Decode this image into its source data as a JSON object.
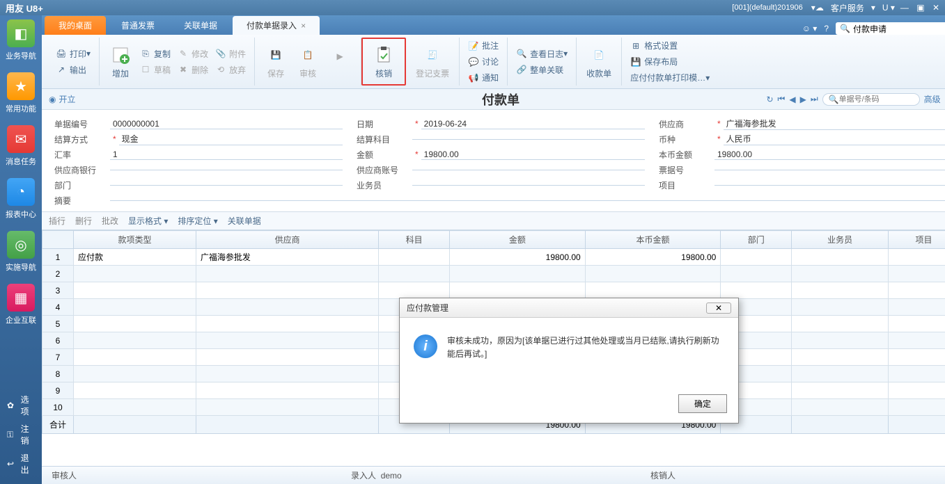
{
  "titlebar": {
    "app": "用友 U8+",
    "session": "[001](default)201906",
    "service": "客户服务"
  },
  "sidebar": {
    "items": [
      {
        "label": "业务导航"
      },
      {
        "label": "常用功能"
      },
      {
        "label": "消息任务"
      },
      {
        "label": "报表中心"
      },
      {
        "label": "实施导航"
      },
      {
        "label": "企业互联"
      }
    ],
    "footer": [
      {
        "label": "选项"
      },
      {
        "label": "注销"
      },
      {
        "label": "退出"
      }
    ]
  },
  "tabs": {
    "items": [
      {
        "label": "我的桌面"
      },
      {
        "label": "普通发票"
      },
      {
        "label": "关联单据"
      },
      {
        "label": "付款单据录入"
      }
    ],
    "search_value": "付款申请"
  },
  "ribbon": {
    "print": "打印",
    "output": "输出",
    "add": "增加",
    "copy": "复制",
    "draft": "草稿",
    "modify": "修改",
    "delete": "删除",
    "attach": "附件",
    "discard": "放弃",
    "save": "保存",
    "audit": "审核",
    "more": "",
    "verify": "核销",
    "register": "登记支票",
    "note": "批注",
    "discuss": "讨论",
    "notify": "通知",
    "viewlog": "查看日志",
    "relate": "整单关联",
    "receipt": "收款单",
    "format": "格式设置",
    "savelayout": "保存布局",
    "printtpl": "应付付款单打印模…"
  },
  "subheader": {
    "open": "开立",
    "title": "付款单",
    "search_ph": "单据号/条码",
    "advanced": "高级"
  },
  "form": {
    "doc_no_lbl": "单据编号",
    "doc_no": "0000000001",
    "date_lbl": "日期",
    "date": "2019-06-24",
    "supplier_lbl": "供应商",
    "supplier": "广福海参批发",
    "settle_lbl": "结算方式",
    "settle": "现金",
    "subject_lbl": "结算科目",
    "subject": "",
    "currency_lbl": "币种",
    "currency": "人民币",
    "rate_lbl": "汇率",
    "rate": "1",
    "amount_lbl": "金额",
    "amount": "19800.00",
    "local_lbl": "本币金额",
    "local": "19800.00",
    "bank_lbl": "供应商银行",
    "bank": "",
    "acct_lbl": "供应商账号",
    "acct": "",
    "bill_lbl": "票据号",
    "bill": "",
    "dept_lbl": "部门",
    "dept": "",
    "clerk_lbl": "业务员",
    "clerk": "",
    "project_lbl": "项目",
    "project": "",
    "summary_lbl": "摘要",
    "summary": ""
  },
  "grid_toolbar": {
    "insrow": "插行",
    "delrow": "删行",
    "batch": "批改",
    "dispfmt": "显示格式",
    "sort": "排序定位",
    "relate": "关联单据"
  },
  "grid": {
    "headers": [
      "款项类型",
      "供应商",
      "科目",
      "金额",
      "本币金额",
      "部门",
      "业务员",
      "项目"
    ],
    "rows": [
      {
        "type": "应付款",
        "supplier": "广福海参批发",
        "subject": "",
        "amount": "19800.00",
        "local": "19800.00",
        "dept": "",
        "clerk": "",
        "project": ""
      }
    ],
    "sum_label": "合计",
    "sum_amount": "19800.00",
    "sum_local": "19800.00"
  },
  "status": {
    "auditor_lbl": "审核人",
    "auditor": "",
    "entry_lbl": "录入人",
    "entry": "demo",
    "verify_lbl": "核销人",
    "verify": ""
  },
  "dialog": {
    "title": "应付款管理",
    "message": "审核未成功，原因为[该单据已进行过其他处理或当月已结账,请执行刷新功能后再试。]",
    "ok": "确定"
  }
}
